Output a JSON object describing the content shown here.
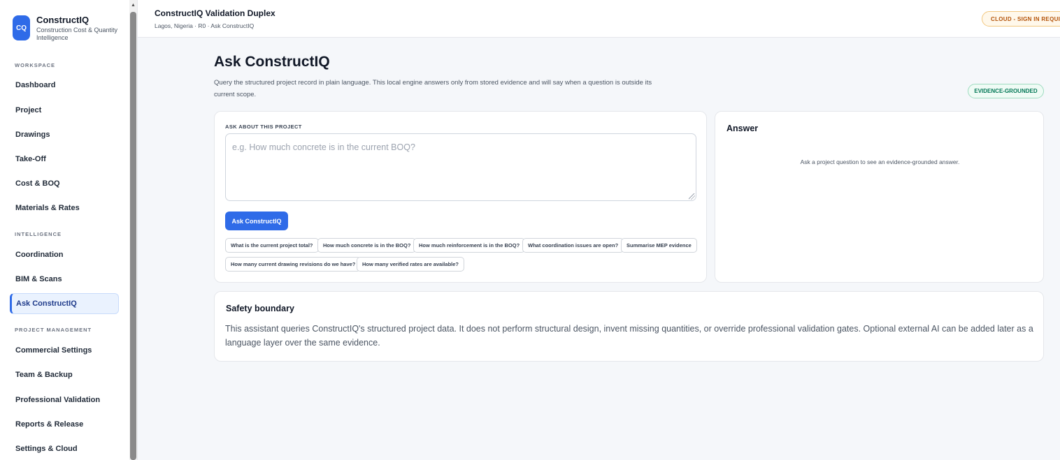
{
  "brand": {
    "logo": "CQ",
    "name": "ConstructIQ",
    "tagline": "Construction Cost & Quantity Intelligence"
  },
  "sidebar": {
    "sections": {
      "workspace": "WORKSPACE",
      "intelligence": "INTELLIGENCE",
      "project_management": "PROJECT MANAGEMENT"
    },
    "items": [
      {
        "label": "Dashboard"
      },
      {
        "label": "Project"
      },
      {
        "label": "Drawings"
      },
      {
        "label": "Take-Off"
      },
      {
        "label": "Cost & BOQ"
      },
      {
        "label": "Materials & Rates"
      },
      {
        "label": "Coordination"
      },
      {
        "label": "BIM & Scans"
      },
      {
        "label": "Ask ConstructIQ",
        "active": true
      },
      {
        "label": "Commercial Settings"
      },
      {
        "label": "Team & Backup"
      },
      {
        "label": "Professional Validation"
      },
      {
        "label": "Reports & Release"
      },
      {
        "label": "Settings & Cloud"
      }
    ]
  },
  "header": {
    "title": "ConstructIQ Validation Duplex",
    "subtitle": "Lagos, Nigeria · R0 · Ask ConstructIQ",
    "cloud_badge": "CLOUD - SIGN IN REQUIRED"
  },
  "main": {
    "title": "Ask ConstructIQ",
    "description": "Query the structured project record in plain language. This local engine answers only from stored evidence and will say when a question is outside its current scope.",
    "badge": "EVIDENCE-GROUNDED",
    "ask": {
      "label": "ASK ABOUT THIS PROJECT",
      "placeholder": "e.g. How much concrete is in the current BOQ?",
      "value": "",
      "button": "Ask ConstructIQ",
      "suggestions": [
        "What is the current project total?",
        "How much concrete is in the BOQ?",
        "How much reinforcement is in the BOQ?",
        "What coordination issues are open?",
        "Summarise MEP evidence",
        "How many current drawing revisions do we have?",
        "How many verified rates are available?"
      ]
    },
    "answer": {
      "title": "Answer",
      "empty_text": "Ask a project question to see an evidence-grounded answer."
    },
    "safety": {
      "title": "Safety boundary",
      "text": "This assistant queries ConstructIQ's structured project data. It does not perform structural design, invent missing quantities, or override professional validation gates. Optional external AI can be added later as a language layer over the same evidence."
    }
  },
  "colors": {
    "accent": "#2f6be8",
    "warning": "#b45309",
    "success": "#047857"
  }
}
